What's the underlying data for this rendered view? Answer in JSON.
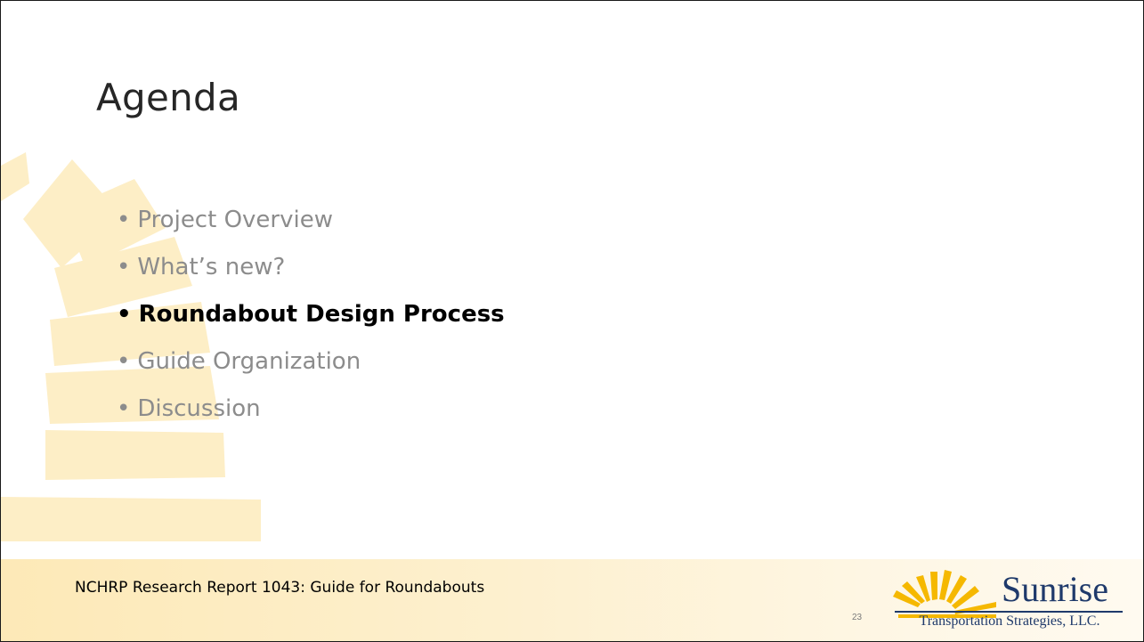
{
  "slide": {
    "title": "Agenda",
    "bullets": [
      {
        "label": "Project Overview",
        "active": false
      },
      {
        "label": "What’s new?",
        "active": false
      },
      {
        "label": "Roundabout Design Process",
        "active": true
      },
      {
        "label": "Guide Organization",
        "active": false
      },
      {
        "label": "Discussion",
        "active": false
      }
    ],
    "bullet_glyph": "•",
    "footer_text": "NCHRP Research Report 1043: Guide for Roundabouts",
    "page_number": "23",
    "logo": {
      "name": "Sunrise",
      "subtitle": "Transportation Strategies, LLC."
    }
  },
  "colors": {
    "title": "#262626",
    "inactive_bullet": "#8c8c8c",
    "active_bullet": "#000000",
    "sunburst": "#fdeec6",
    "logo_sun": "#f5b800",
    "logo_text": "#1f3a6b"
  }
}
